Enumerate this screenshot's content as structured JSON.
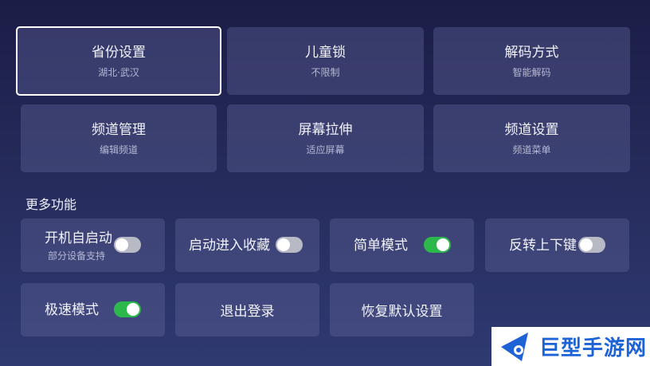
{
  "grid": [
    {
      "title": "省份设置",
      "sub": "湖北·武汉"
    },
    {
      "title": "儿童锁",
      "sub": "不限制"
    },
    {
      "title": "解码方式",
      "sub": "智能解码"
    },
    {
      "title": "频道管理",
      "sub": "编辑频道"
    },
    {
      "title": "屏幕拉伸",
      "sub": "适应屏幕"
    },
    {
      "title": "频道设置",
      "sub": "频道菜单"
    }
  ],
  "more": {
    "title": "更多功能",
    "items": [
      {
        "label": "开机自启动",
        "sub": "部分设备支持",
        "toggle": "off"
      },
      {
        "label": "启动进入收藏",
        "toggle": "off"
      },
      {
        "label": "简单模式",
        "toggle": "on"
      },
      {
        "label": "反转上下键",
        "toggle": "off"
      },
      {
        "label": "极速模式",
        "toggle": "on"
      },
      {
        "label": "退出登录"
      },
      {
        "label": "恢复默认设置"
      }
    ]
  },
  "watermark": {
    "text": "巨型手游网",
    "icon": "brand-logo-icon"
  },
  "colors": {
    "toggle_on": "#2db84c",
    "toggle_off": "#b7b9c4",
    "focus_border": "#ffffff"
  }
}
